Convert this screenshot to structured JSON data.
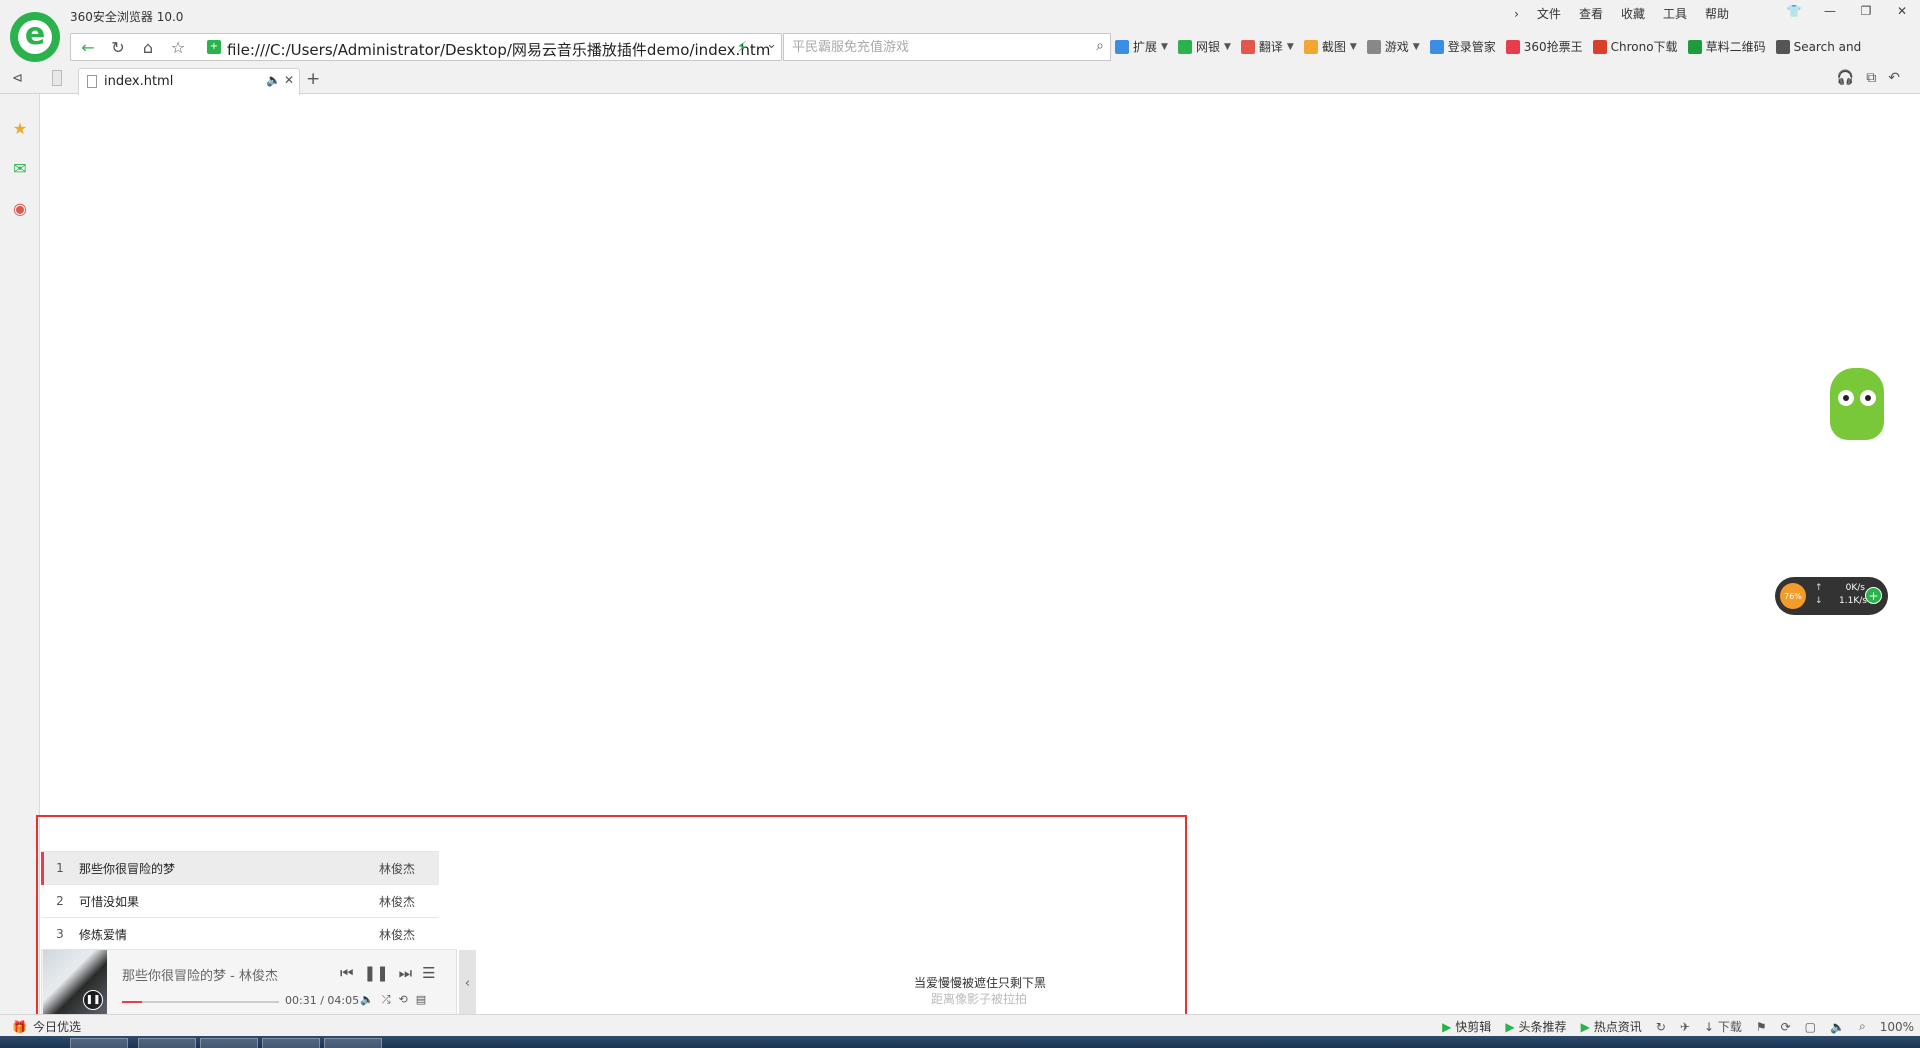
{
  "browser": {
    "title": "360安全浏览器 10.0",
    "menu": [
      "文件",
      "查看",
      "收藏",
      "工具",
      "帮助"
    ],
    "address_url": "file:///C:/Users/Administrator/Desktop/网易云音乐播放插件demo/index.htm",
    "search_placeholder": "平民霸服免充值游戏",
    "extensions": [
      {
        "label": "扩展",
        "icon": "extensions-icon",
        "color": "#3a8ee6",
        "caret": true
      },
      {
        "label": "网银",
        "icon": "ebank-icon",
        "color": "#2bb24c",
        "caret": true
      },
      {
        "label": "翻译",
        "icon": "translate-icon",
        "color": "#e2574c",
        "caret": true
      },
      {
        "label": "截图",
        "icon": "screenshot-icon",
        "color": "#f0a830",
        "caret": true
      },
      {
        "label": "游戏",
        "icon": "game-icon",
        "color": "#888888",
        "caret": true
      },
      {
        "label": "登录管家",
        "icon": "login-manager-icon",
        "color": "#3a8ee6",
        "caret": false
      },
      {
        "label": "360抢票王",
        "icon": "ticket-icon",
        "color": "#e83c4f",
        "caret": false
      },
      {
        "label": "Chrono下载",
        "icon": "chrono-icon",
        "color": "#d9402b",
        "caret": false
      },
      {
        "label": "草料二维码",
        "icon": "qrcode-icon",
        "color": "#1c9c3a",
        "caret": false
      },
      {
        "label": "Search and",
        "icon": "search-ext-icon",
        "color": "#555555",
        "caret": false
      }
    ],
    "tab": {
      "title": "index.html"
    }
  },
  "player": {
    "playlist": [
      {
        "num": "1",
        "title": "那些你很冒险的梦",
        "artist": "林俊杰",
        "active": true
      },
      {
        "num": "2",
        "title": "可惜没如果",
        "artist": "林俊杰",
        "active": false
      },
      {
        "num": "3",
        "title": "修炼爱情",
        "artist": "林俊杰",
        "active": false
      }
    ],
    "now_playing": "那些你很冒险的梦 - 林俊杰",
    "time": "00:31 / 04:05",
    "progress": 0.127,
    "lyric_current": "当爱慢慢被遮住只剩下黑",
    "lyric_next": "距离像影子被拉拍"
  },
  "net_widget": {
    "percent": "76%",
    "up": "0K/s",
    "down": "1.1K/s"
  },
  "statusbar": {
    "left_label": "今日优选",
    "items": [
      {
        "label": "快剪辑",
        "icon": "video-edit-icon"
      },
      {
        "label": "头条推荐",
        "icon": "headline-icon"
      },
      {
        "label": "热点资讯",
        "icon": "news-icon"
      }
    ],
    "download_label": "下载",
    "zoom": "100%"
  },
  "colors": {
    "accent_green": "#2bb24c",
    "player_red": "#e83c4f",
    "highlight_box": "#e53333"
  }
}
